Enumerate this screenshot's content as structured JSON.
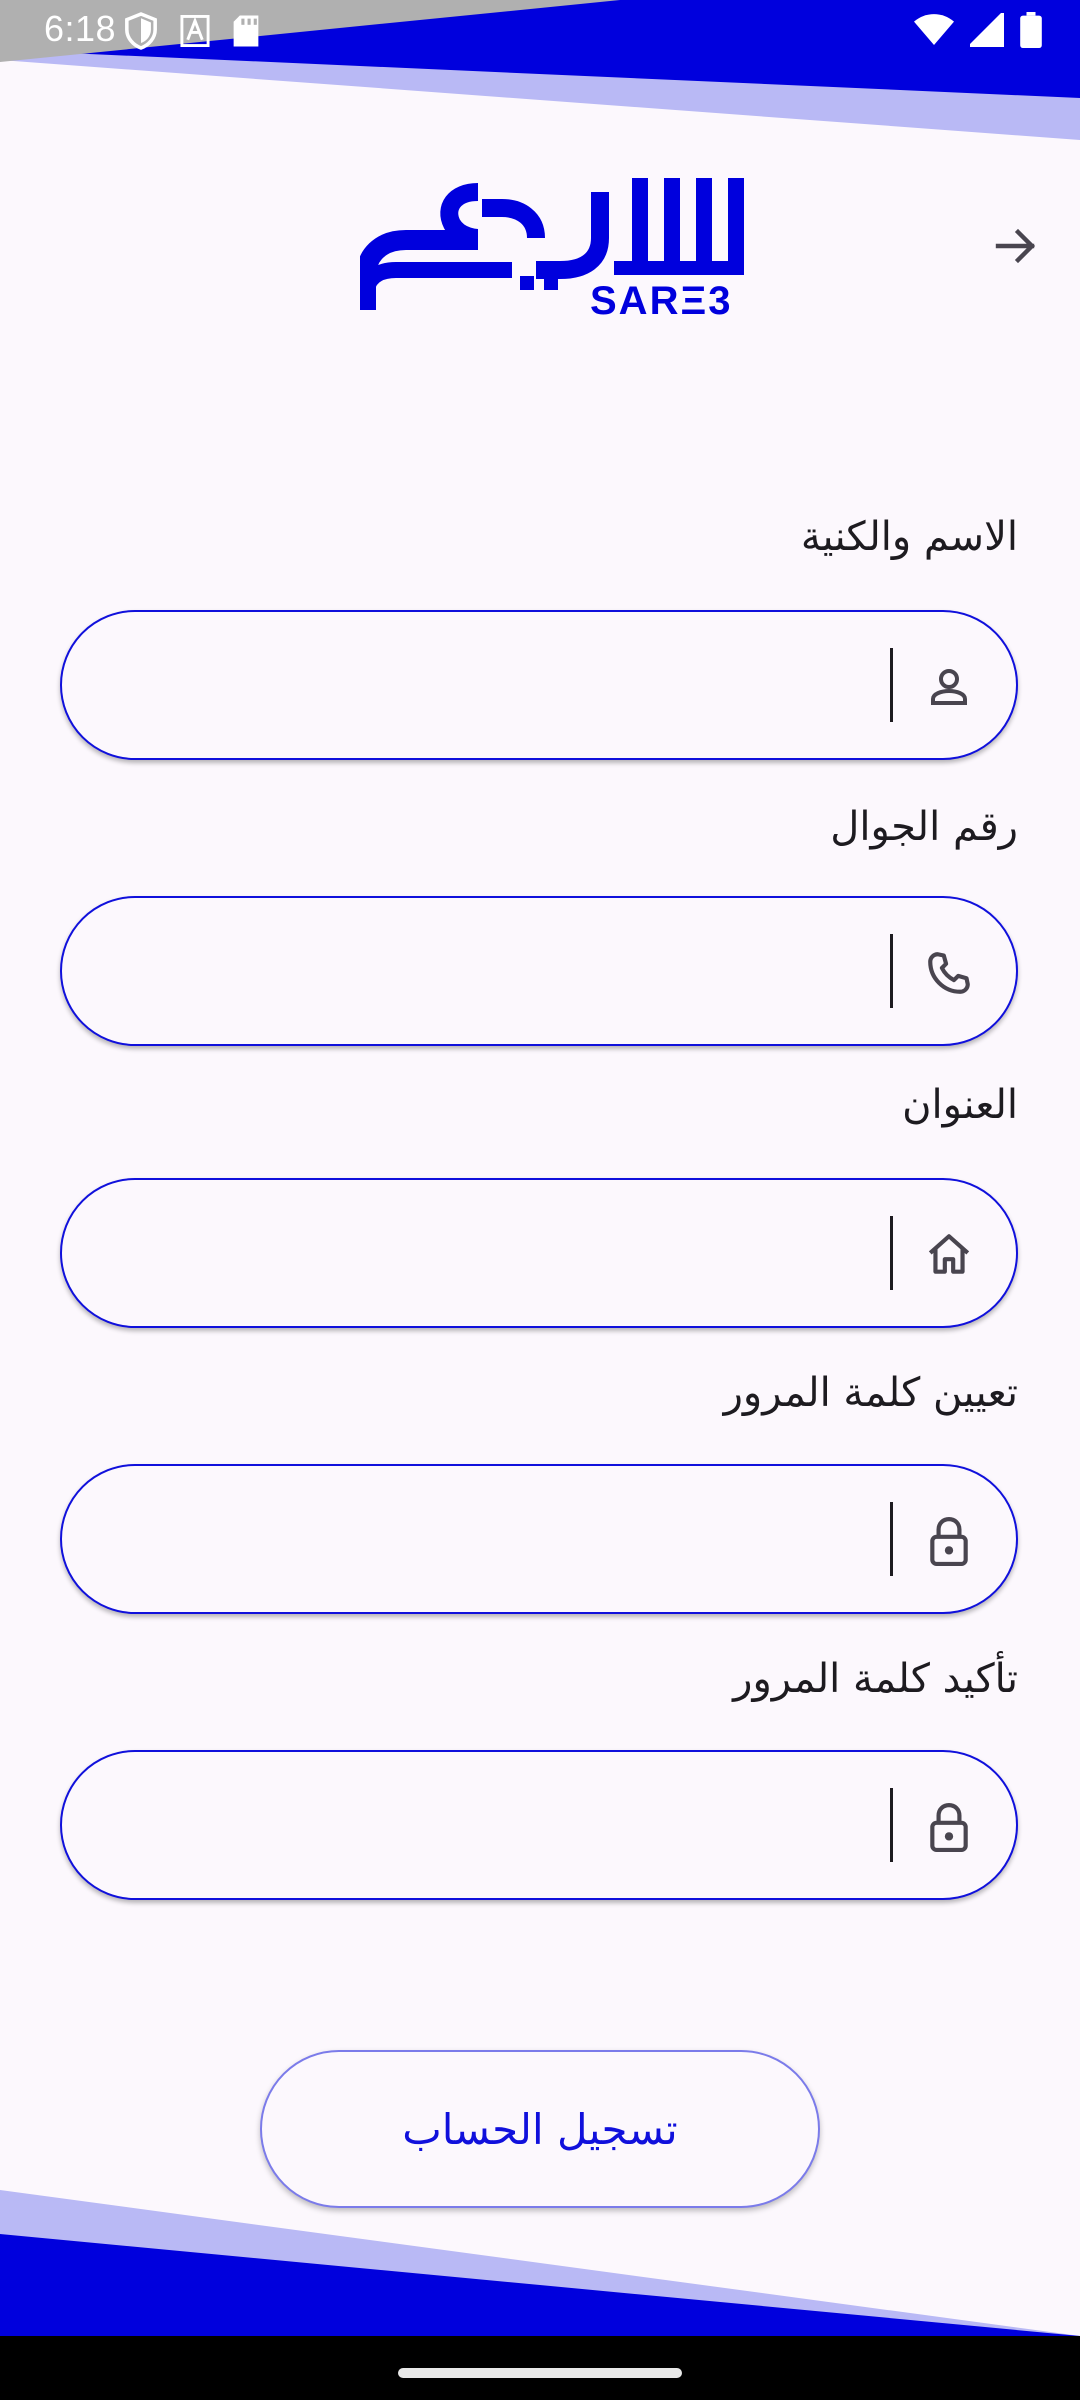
{
  "status_bar": {
    "time": "6:18",
    "icons": [
      "shield-icon",
      "text-a-icon",
      "sd-card-icon",
      "wifi-icon",
      "signal-icon",
      "battery-icon"
    ]
  },
  "header": {
    "back_icon": "arrow-right-icon",
    "logo_text": "SARΞ3",
    "logo_arabic": "سريع"
  },
  "form": {
    "fields": [
      {
        "label": "الاسم والكنية",
        "value": "",
        "icon": "person-icon"
      },
      {
        "label": "رقم الجوال",
        "value": "",
        "icon": "phone-icon"
      },
      {
        "label": "العنوان",
        "value": "",
        "icon": "home-icon"
      },
      {
        "label": "تعيين كلمة المرور",
        "value": "",
        "icon": "lock-icon"
      },
      {
        "label": "تأكيد كلمة المرور",
        "value": "",
        "icon": "lock-icon"
      }
    ],
    "submit_label": "تسجيل الحساب"
  },
  "colors": {
    "brand_blue": "#0000dd",
    "light_blue": "#b9b9f5",
    "background": "#fcf8fd",
    "field_border": "#1010dc",
    "button_border": "#7b7bea"
  }
}
